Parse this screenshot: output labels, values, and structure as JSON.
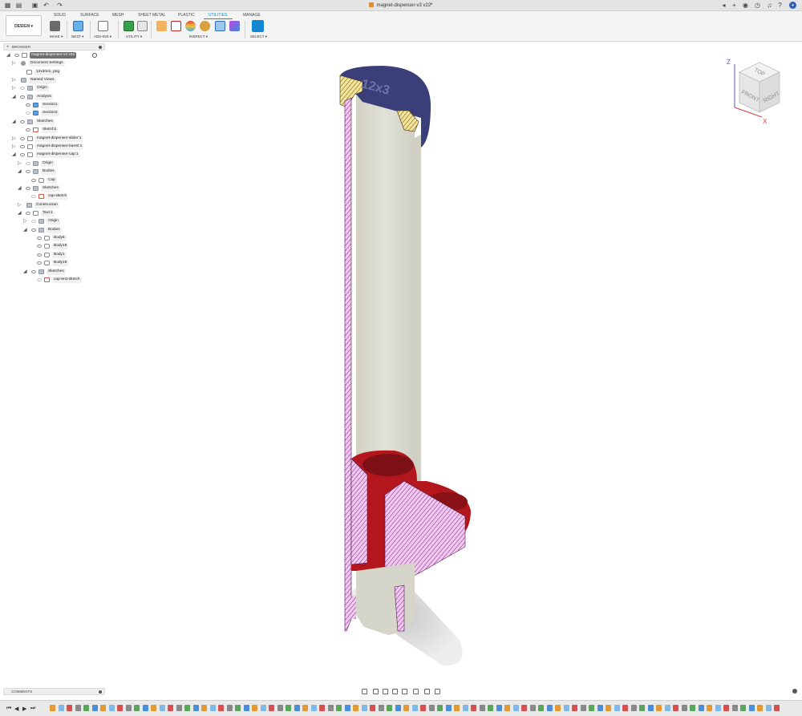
{
  "window": {
    "document_title": "magnet-dispenser-v3 v22*",
    "tab_close": "×"
  },
  "ribbon": {
    "workspace_button": "DESIGN ▾",
    "tabs": [
      "SOLID",
      "SURFACE",
      "MESH",
      "SHEET METAL",
      "PLASTIC",
      "UTILITIES",
      "MANAGE"
    ],
    "active_tab": "UTILITIES",
    "groups": {
      "make": "MAKE ▾",
      "nest": "NEST ▾",
      "addins": "ADD-INS ▾",
      "utility": "UTILITY ▾",
      "inspect": "INSPECT ▾",
      "select": "SELECT ▾"
    }
  },
  "browser": {
    "header": "BROWSER",
    "items": [
      {
        "label": "magnet-dispenser-v3 v22",
        "root": true
      },
      {
        "label": "Document Settings"
      },
      {
        "label": "12x3mm, peg"
      },
      {
        "label": "Named Views"
      },
      {
        "label": "Origin"
      },
      {
        "label": "Analysis"
      },
      {
        "label": "Section1"
      },
      {
        "label": "Section2"
      },
      {
        "label": "Sketches"
      },
      {
        "label": "Sketch1"
      },
      {
        "label": "magnet-dispenser-slider:1"
      },
      {
        "label": "magnet-dispenser-barrel:1"
      },
      {
        "label": "magnet-dispenser-cap:1"
      },
      {
        "label": "Origin"
      },
      {
        "label": "Bodies"
      },
      {
        "label": "Cap"
      },
      {
        "label": "Sketches"
      },
      {
        "label": "cap-sketch"
      },
      {
        "label": "Construction"
      },
      {
        "label": "Text:1"
      },
      {
        "label": "Origin"
      },
      {
        "label": "Bodies"
      },
      {
        "label": "Body8"
      },
      {
        "label": "Body18"
      },
      {
        "label": "Body1"
      },
      {
        "label": "Body19"
      },
      {
        "label": "Sketches"
      },
      {
        "label": "cap-text-sketch"
      }
    ]
  },
  "viewcube": {
    "top": "TOP",
    "front": "FRONT",
    "right": "RIGHT",
    "axis_z": "Z",
    "axis_x": "X"
  },
  "model": {
    "cap_text": "12x3"
  },
  "comments": {
    "header": "COMMENTS"
  },
  "timeline": {
    "controls": [
      "⏮",
      "◀",
      "▶",
      "⏭"
    ]
  }
}
